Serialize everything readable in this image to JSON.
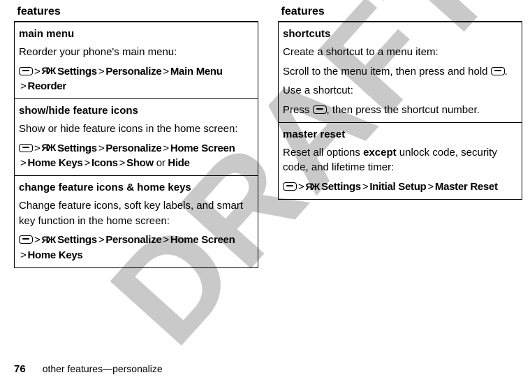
{
  "watermark": "DRAFT",
  "headers": {
    "left": "features",
    "right": "features"
  },
  "settings_glyph": "ЯЖ",
  "left_table": {
    "rows": [
      {
        "title": "main menu",
        "desc": "Reorder your phone's main menu:",
        "path_parts": {
          "settings": "Settings",
          "p1": "Personalize",
          "p2": "Main Menu",
          "p3": "Reorder"
        }
      },
      {
        "title": "show/hide feature icons",
        "desc": "Show or hide feature icons in the home screen:",
        "path_parts": {
          "settings": "Settings",
          "p1": "Personalize",
          "p2": "Home Screen",
          "p3": "Home Keys",
          "p4": "Icons",
          "p5": "Show",
          "or": " or ",
          "p6": "Hide"
        }
      },
      {
        "title": "change feature icons & home keys",
        "desc": "Change feature icons, soft key labels, and smart key function in the home screen:",
        "path_parts": {
          "settings": "Settings",
          "p1": "Personalize",
          "p2": "Home Screen",
          "p3": "Home Keys"
        }
      }
    ]
  },
  "right_table": {
    "rows": [
      {
        "title": "shortcuts",
        "desc": "Create a shortcut to a menu item:",
        "line2a": "Scroll to the menu item, then press and hold ",
        "line2b": ".",
        "line3": "Use a shortcut:",
        "line4a": "Press ",
        "line4b": ", then press the shortcut number."
      },
      {
        "title": "master reset",
        "desc_a": "Reset all options ",
        "desc_bold": "except",
        "desc_b": " unlock code, security code, and lifetime timer:",
        "path_parts": {
          "settings": "Settings",
          "p1": "Initial Setup",
          "p2": "Master Reset"
        }
      }
    ]
  },
  "footer": {
    "page": "76",
    "text": "other features—personalize"
  }
}
